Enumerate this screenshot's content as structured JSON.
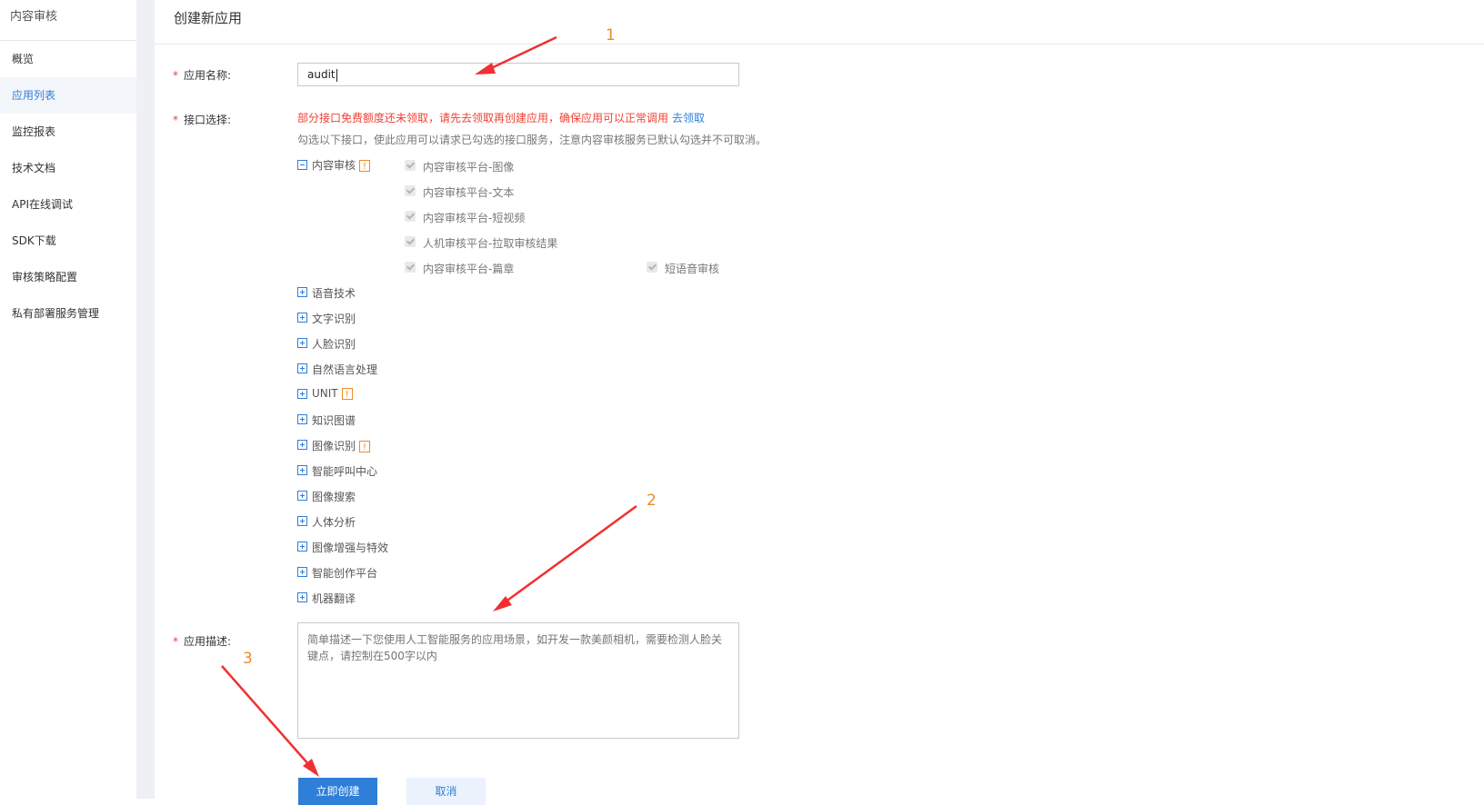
{
  "sidebar": {
    "title": "内容审核",
    "items": [
      {
        "label": "概览",
        "active": false
      },
      {
        "label": "应用列表",
        "active": true
      },
      {
        "label": "监控报表",
        "active": false
      },
      {
        "label": "技术文档",
        "active": false
      },
      {
        "label": "API在线调试",
        "active": false
      },
      {
        "label": "SDK下载",
        "active": false
      },
      {
        "label": "审核策略配置",
        "active": false
      },
      {
        "label": "私有部署服务管理",
        "active": false
      }
    ]
  },
  "main": {
    "title": "创建新应用",
    "form": {
      "required_mark": "*",
      "app_name_label": "应用名称:",
      "app_name_value": "audit",
      "api_select_label": "接口选择:",
      "warning_text": "部分接口免费额度还未领取，请先去领取再创建应用，确保应用可以正常调用",
      "warning_link": "去领取",
      "hint_text": "勾选以下接口，使此应用可以请求已勾选的接口服务，注意内容审核服务已默认勾选并不可取消。",
      "expanded_group": {
        "label": "内容审核",
        "badge": "!",
        "checkboxes": [
          "内容审核平台-图像",
          "内容审核平台-文本",
          "内容审核平台-短视频",
          "人机审核平台-拉取审核结果",
          "内容审核平台-篇章",
          "短语音审核"
        ]
      },
      "collapsed_groups": [
        {
          "label": "语音技术",
          "badge": ""
        },
        {
          "label": "文字识别",
          "badge": ""
        },
        {
          "label": "人脸识别",
          "badge": ""
        },
        {
          "label": "自然语言处理",
          "badge": ""
        },
        {
          "label": "UNIT",
          "badge": "!"
        },
        {
          "label": "知识图谱",
          "badge": ""
        },
        {
          "label": "图像识别",
          "badge": "!"
        },
        {
          "label": "智能呼叫中心",
          "badge": ""
        },
        {
          "label": "图像搜索",
          "badge": ""
        },
        {
          "label": "人体分析",
          "badge": ""
        },
        {
          "label": "图像增强与特效",
          "badge": ""
        },
        {
          "label": "智能创作平台",
          "badge": ""
        },
        {
          "label": "机器翻译",
          "badge": ""
        }
      ],
      "desc_label": "应用描述:",
      "desc_placeholder": "简单描述一下您使用人工智能服务的应用场景，如开发一款美颜相机，需要检测人脸关键点，请控制在500字以内",
      "submit_label": "立即创建",
      "cancel_label": "取消"
    }
  },
  "annotations": {
    "step1": "1",
    "step2": "2",
    "step3": "3",
    "arrow_color": "#f03030",
    "number_color": "#f08a24"
  },
  "colors": {
    "accent": "#2f7ed8",
    "warning": "#f04134",
    "badge": "#f08a24"
  }
}
